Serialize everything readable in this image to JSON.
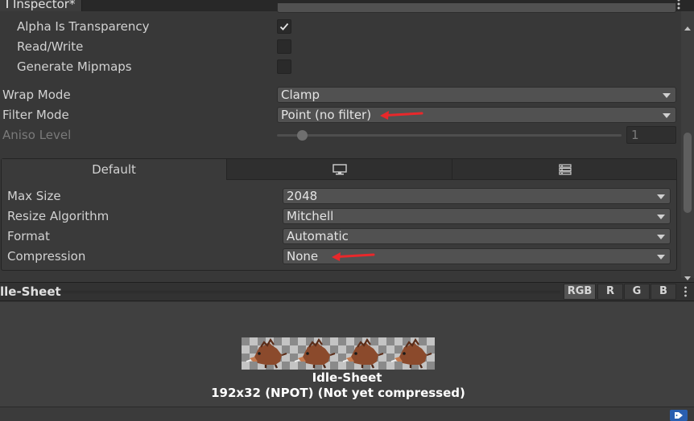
{
  "window": {
    "title": "Inspector*"
  },
  "settings": {
    "alpha_is_transparency": {
      "label": "Alpha Is Transparency",
      "checked": true
    },
    "read_write": {
      "label": "Read/Write",
      "checked": false
    },
    "generate_mipmaps": {
      "label": "Generate Mipmaps",
      "checked": false
    },
    "wrap_mode": {
      "label": "Wrap Mode",
      "value": "Clamp"
    },
    "filter_mode": {
      "label": "Filter Mode",
      "value": "Point (no filter)"
    },
    "aniso_level": {
      "label": "Aniso Level",
      "value": "1",
      "slider_fraction": 0.0
    }
  },
  "platform": {
    "tabs": [
      {
        "label": "Default",
        "icon": "none"
      },
      {
        "label": "",
        "icon": "monitor-icon"
      },
      {
        "label": "",
        "icon": "server-icon"
      }
    ],
    "max_size": {
      "label": "Max Size",
      "value": "2048"
    },
    "resize_algorithm": {
      "label": "Resize Algorithm",
      "value": "Mitchell"
    },
    "format": {
      "label": "Format",
      "value": "Automatic"
    },
    "compression": {
      "label": "Compression",
      "value": "None"
    }
  },
  "preview": {
    "asset_title": "lle-Sheet",
    "channels": [
      "RGB",
      "R",
      "G",
      "B"
    ],
    "name": "Idle-Sheet",
    "info": "192x32 (NPOT) (Not yet compressed)",
    "frame_count": 4
  },
  "colors": {
    "annotation_arrow": "#e8282b",
    "background": "#383838",
    "field": "#515151"
  }
}
